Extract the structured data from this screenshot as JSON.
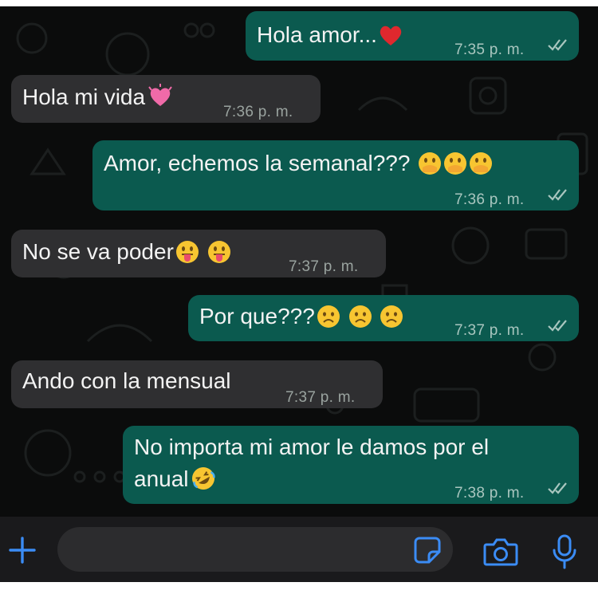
{
  "messages": [
    {
      "direction": "outgoing",
      "text": "Hola amor...",
      "emojis": [
        "red-heart"
      ],
      "time": "7:35 p. m.",
      "status": "read"
    },
    {
      "direction": "incoming",
      "text": "Hola mi vida",
      "emojis": [
        "sparkling-heart"
      ],
      "time": "7:36 p. m."
    },
    {
      "direction": "outgoing",
      "text": "Amor, echemos la semanal???",
      "emojis": [
        "hand-over-mouth",
        "hand-over-mouth",
        "hand-over-mouth"
      ],
      "time": "7:36 p. m.",
      "status": "read"
    },
    {
      "direction": "incoming",
      "text": "No se va poder",
      "emojis": [
        "tongue-out",
        "tongue-out"
      ],
      "time": "7:37 p. m."
    },
    {
      "direction": "outgoing",
      "text": "Por que???",
      "emojis": [
        "frowning-face",
        "frowning-face",
        "frowning-face"
      ],
      "time": "7:37 p. m.",
      "status": "read"
    },
    {
      "direction": "incoming",
      "text": "Ando con la mensual",
      "emojis": [],
      "time": "7:37 p. m."
    },
    {
      "direction": "outgoing",
      "text_line1": "No importa mi amor le damos por el",
      "text_line2": "anual",
      "emojis": [
        "rolling-laughing"
      ],
      "time": "7:38 p. m.",
      "status": "read"
    }
  ],
  "input_bar": {
    "icons": [
      "plus-icon",
      "sticker-icon",
      "camera-icon",
      "microphone-icon"
    ],
    "accent_color": "#3b8cf5"
  },
  "colors": {
    "background": "#0b0c0c",
    "incoming_bubble": "#2f2f31",
    "outgoing_bubble": "#0b5a4f",
    "read_ticks": "#9fb6b0"
  }
}
